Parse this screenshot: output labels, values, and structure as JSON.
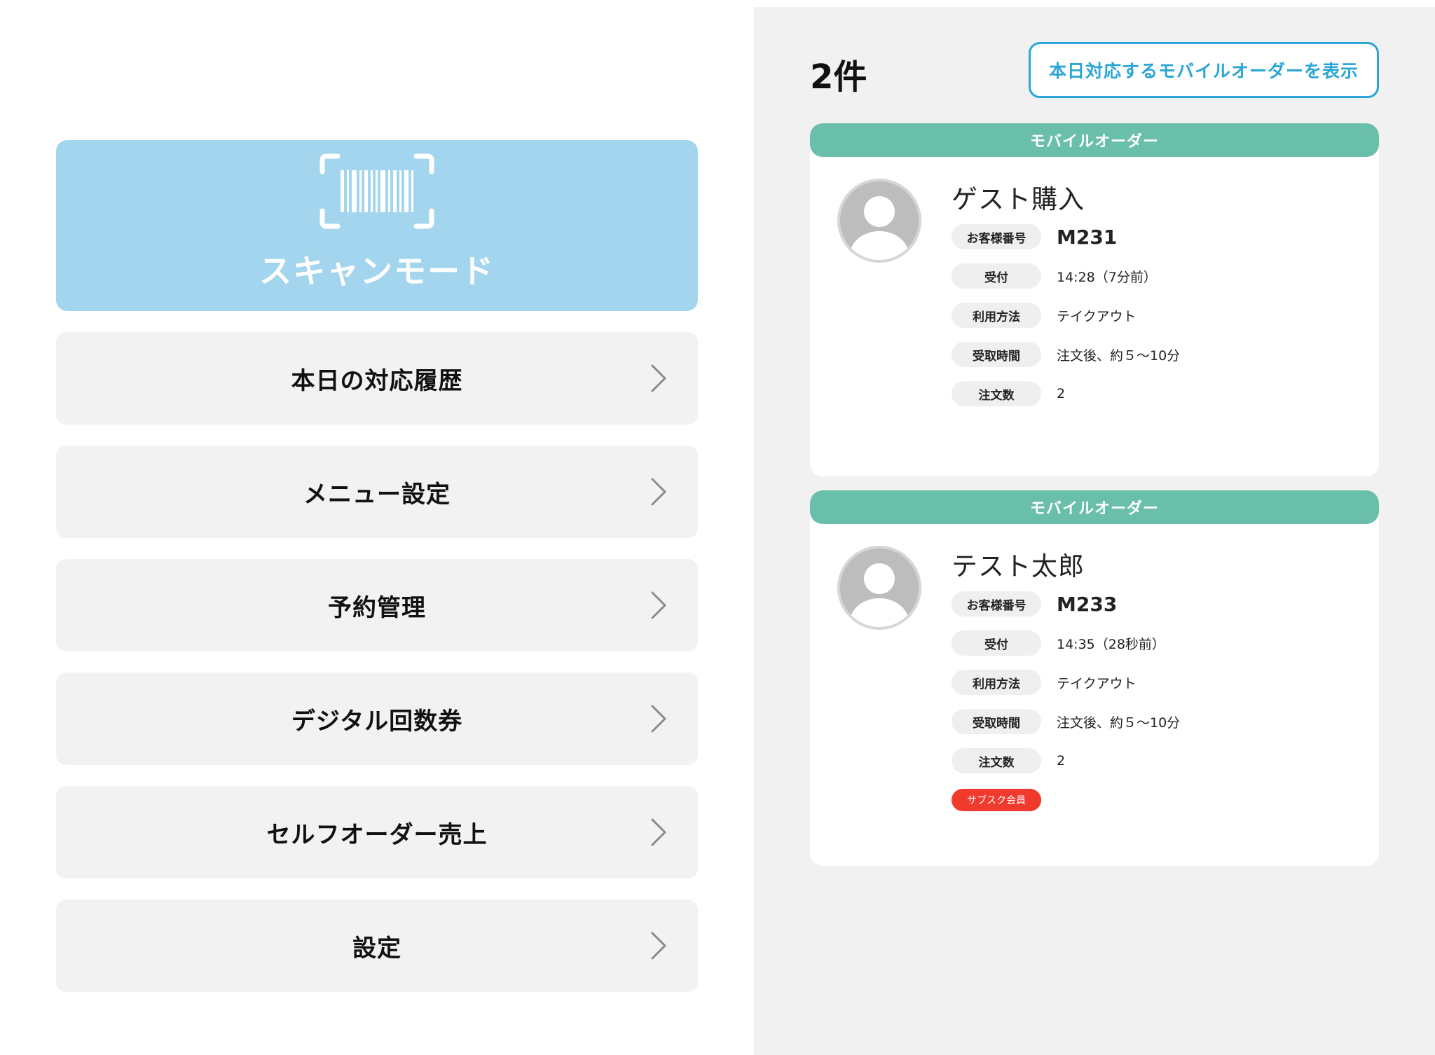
{
  "menu": {
    "scan_mode_label": "スキャンモード",
    "items": [
      {
        "label": "本日の対応履歴"
      },
      {
        "label": "メニュー設定"
      },
      {
        "label": "予約管理"
      },
      {
        "label": "デジタル回数券"
      },
      {
        "label": "セルフオーダー売上"
      },
      {
        "label": "設定"
      }
    ]
  },
  "orders_panel": {
    "count_label": "2件",
    "show_today_button": "本日対応するモバイルオーダーを表示",
    "field_labels": {
      "customer_number": "お客様番号",
      "received": "受付",
      "usage": "利用方法",
      "pickup_time": "受取時間",
      "order_count": "注文数"
    },
    "orders": [
      {
        "header": "モバイルオーダー",
        "name": "ゲスト購入",
        "customer_number": "M231",
        "received": "14:28（7分前）",
        "usage": "テイクアウト",
        "pickup_time": "注文後、約５〜10分",
        "order_count": "2"
      },
      {
        "header": "モバイルオーダー",
        "name": "テスト太郎",
        "customer_number": "M233",
        "received": "14:35（28秒前）",
        "usage": "テイクアウト",
        "pickup_time": "注文後、約５〜10分",
        "order_count": "2",
        "badge": "サブスク会員"
      }
    ]
  },
  "colors": {
    "scan_card": "#a3d6ee",
    "order_header": "#6abfaa",
    "accent_button": "#2aa6d6",
    "subscription_badge": "#f03a2e"
  }
}
